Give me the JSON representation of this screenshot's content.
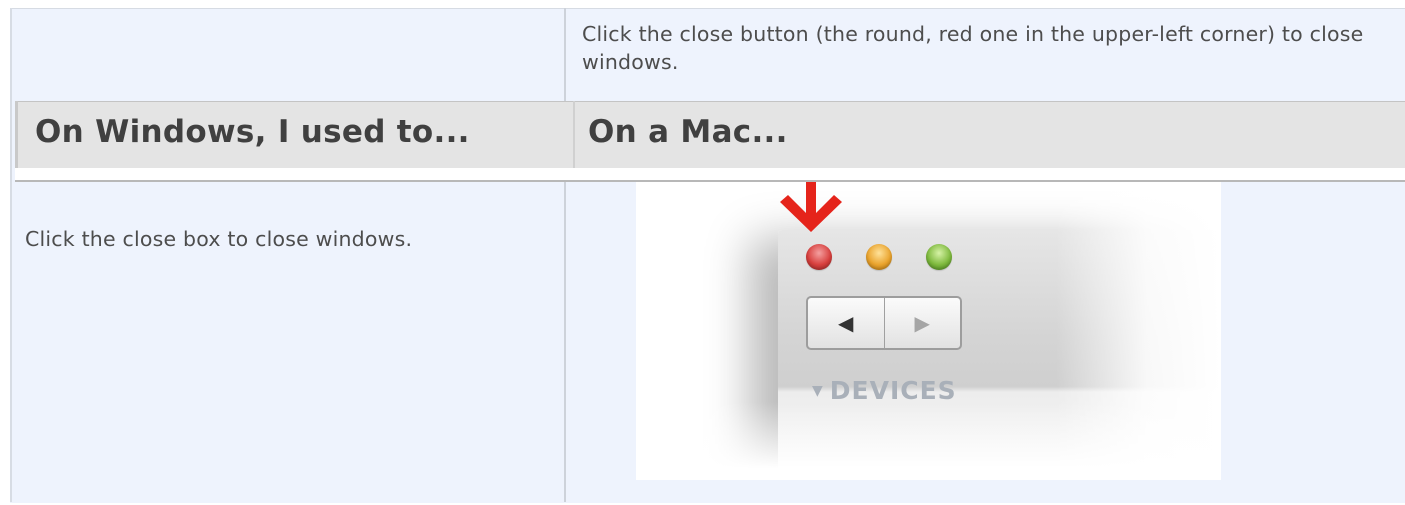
{
  "top_cell": {
    "text": "Click the close button (the round, red one in the upper-left corner) to close windows."
  },
  "header": {
    "left": "On Windows, I used to...",
    "right": "On a Mac..."
  },
  "body_left": {
    "text": "Click the close box to close windows."
  },
  "screenshot": {
    "devices_label": "DEVICES",
    "devices_triangle": "▼",
    "back_glyph": "◀",
    "forward_glyph": "▶",
    "arrow_icon": "down-arrow-icon",
    "colors": {
      "arrow": "#e5241b",
      "close": "#d8403e",
      "minimize": "#eaa42e",
      "zoom": "#7fba3e",
      "background": "#eef3fd",
      "header": "#e4e4e4"
    }
  }
}
